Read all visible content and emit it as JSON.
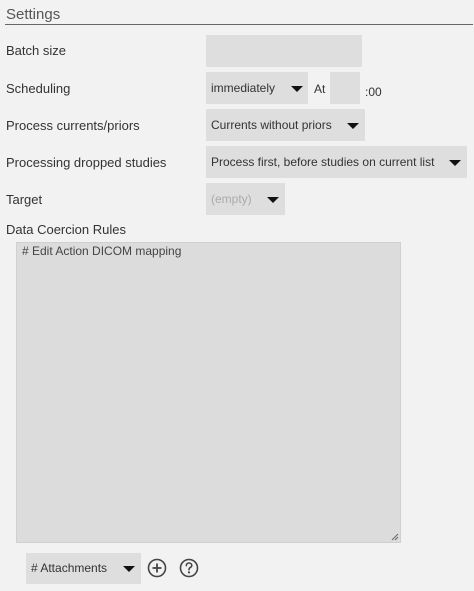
{
  "header": {
    "title": "Settings"
  },
  "fields": {
    "batch_size": {
      "label": "Batch size",
      "value": ""
    },
    "scheduling": {
      "label": "Scheduling",
      "selected": "immediately",
      "at_label": "At",
      "minute_value": "",
      "minutes_suffix": ":00"
    },
    "process_currents": {
      "label": "Process currents/priors",
      "selected": "Currents without priors"
    },
    "processing_dropped": {
      "label": "Processing dropped studies",
      "selected": "Process first, before studies on current list"
    },
    "target": {
      "label": "Target",
      "selected": "(empty)"
    }
  },
  "coercion": {
    "label": "Data Coercion Rules",
    "content": "# Edit Action DICOM mapping"
  },
  "footer": {
    "attachments_selected": "# Attachments",
    "add_icon": "plus-circle-icon",
    "help_icon": "question-circle-icon"
  }
}
